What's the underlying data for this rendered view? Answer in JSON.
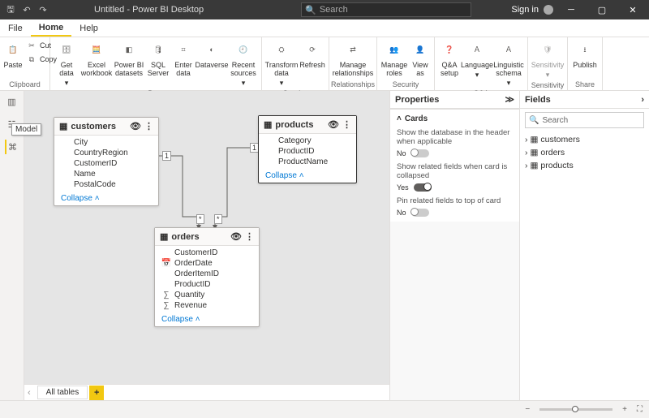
{
  "titlebar": {
    "title": "Untitled - Power BI Desktop",
    "search_placeholder": "Search",
    "signin": "Sign in"
  },
  "menu": {
    "file": "File",
    "home": "Home",
    "help": "Help"
  },
  "ribbon": {
    "clipboard": {
      "label": "Clipboard",
      "paste": "Paste",
      "cut": "Cut",
      "copy": "Copy"
    },
    "data": {
      "label": "Data",
      "getdata": "Get data",
      "excel": "Excel workbook",
      "pbi": "Power BI datasets",
      "sql": "SQL Server",
      "enter": "Enter data",
      "dataverse": "Dataverse",
      "recent": "Recent sources"
    },
    "queries": {
      "label": "Queries",
      "transform": "Transform data",
      "refresh": "Refresh"
    },
    "relationships": {
      "label": "Relationships",
      "manage": "Manage relationships"
    },
    "security": {
      "label": "Security",
      "roles": "Manage roles",
      "viewas": "View as"
    },
    "qa": {
      "label": "Q&A",
      "setup": "Q&A setup",
      "lang": "Language",
      "schema": "Linguistic schema"
    },
    "sensitivity": {
      "label": "Sensitivity",
      "btn": "Sensitivity"
    },
    "share": {
      "label": "Share",
      "publish": "Publish"
    }
  },
  "leftnav": {
    "tooltip": "Model"
  },
  "cards": {
    "customers": {
      "title": "customers",
      "fields": [
        "City",
        "CountryRegion",
        "CustomerID",
        "Name",
        "PostalCode"
      ],
      "collapse": "Collapse"
    },
    "products": {
      "title": "products",
      "fields": [
        "Category",
        "ProductID",
        "ProductName"
      ],
      "collapse": "Collapse"
    },
    "orders": {
      "title": "orders",
      "fields": [
        "CustomerID",
        "OrderDate",
        "OrderItemID",
        "ProductID",
        "Quantity",
        "Revenue"
      ],
      "collapse": "Collapse"
    }
  },
  "rel": {
    "one": "1",
    "many": "*"
  },
  "properties": {
    "title": "Properties",
    "cards": "Cards",
    "p1": "Show the database in the header when applicable",
    "p1v": "No",
    "p2": "Show related fields when card is collapsed",
    "p2v": "Yes",
    "p3": "Pin related fields to top of card",
    "p3v": "No"
  },
  "fields": {
    "title": "Fields",
    "search": "Search",
    "nodes": [
      "customers",
      "orders",
      "products"
    ]
  },
  "pagebar": {
    "tab": "All tables"
  }
}
